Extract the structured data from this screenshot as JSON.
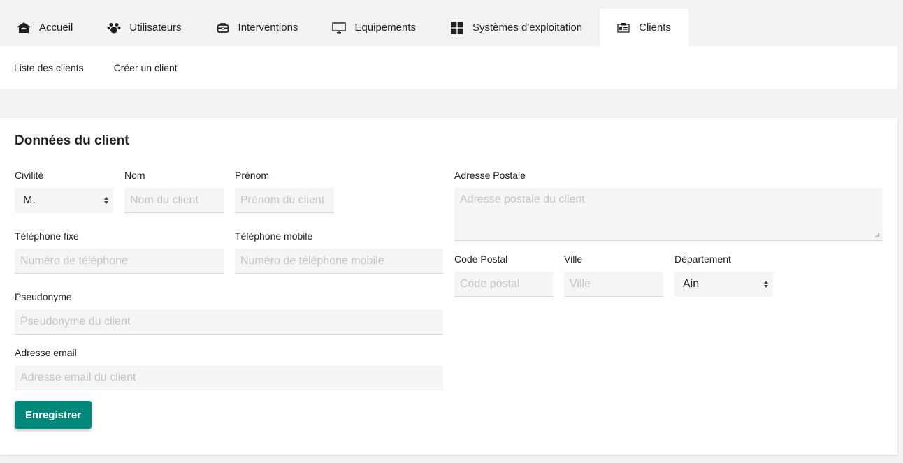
{
  "tabs": [
    {
      "label": "Accueil",
      "icon": "home-icon"
    },
    {
      "label": "Utilisateurs",
      "icon": "users-icon"
    },
    {
      "label": "Interventions",
      "icon": "toolbox-icon"
    },
    {
      "label": "Equipements",
      "icon": "monitor-icon"
    },
    {
      "label": "Systèmes d'exploitation",
      "icon": "windows-icon"
    },
    {
      "label": "Clients",
      "icon": "id-card-icon",
      "active": true
    }
  ],
  "subnav": {
    "list_label": "Liste des clients",
    "create_label": "Créer un client"
  },
  "form": {
    "title": "Données du client",
    "civilite": {
      "label": "Civilité",
      "value": "M."
    },
    "nom": {
      "label": "Nom",
      "placeholder": "Nom du client"
    },
    "prenom": {
      "label": "Prénom",
      "placeholder": "Prénom du client"
    },
    "tel_fixe": {
      "label": "Téléphone fixe",
      "placeholder": "Numéro de téléphone"
    },
    "tel_mobile": {
      "label": "Téléphone mobile",
      "placeholder": "Numéro de téléphone mobile"
    },
    "pseudo": {
      "label": "Pseudonyme",
      "placeholder": "Pseudonyme du client"
    },
    "email": {
      "label": "Adresse email",
      "placeholder": "Adresse email du client"
    },
    "adresse": {
      "label": "Adresse Postale",
      "placeholder": "Adresse postale du client"
    },
    "code_postal": {
      "label": "Code Postal",
      "placeholder": "Code postal"
    },
    "ville": {
      "label": "Ville",
      "placeholder": "Ville"
    },
    "departement": {
      "label": "Département",
      "value": "Ain"
    },
    "submit_label": "Enregistrer"
  },
  "colors": {
    "accent": "#00897b",
    "background": "#f2f2f2",
    "field_bg": "#f5f5f5"
  }
}
